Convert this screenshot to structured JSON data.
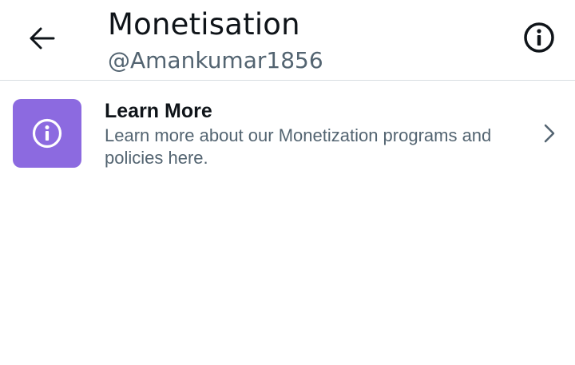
{
  "header": {
    "title": "Monetisation",
    "handle": "@Amankumar1856"
  },
  "icons": {
    "back": "arrow-left-icon",
    "info": "info-circle-icon",
    "tile": "info-circle-icon",
    "chevron": "chevron-right-icon"
  },
  "items": [
    {
      "title": "Learn More",
      "description": "Learn more about our Monetization programs and policies here."
    }
  ],
  "colors": {
    "accent_tile": "#8c6ae0",
    "text_primary": "#0f1419",
    "text_secondary": "#536471",
    "divider": "#d8dde1"
  }
}
